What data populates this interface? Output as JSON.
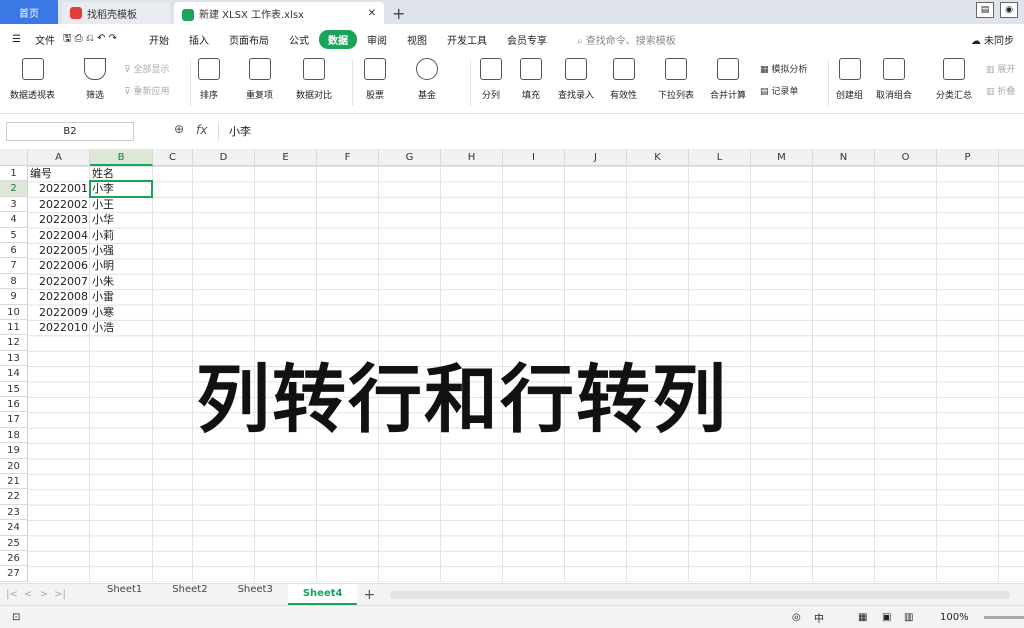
{
  "tabs": {
    "home": "首页",
    "template": "找稻壳模板",
    "file": "新建 XLSX 工作表.xlsx",
    "add": "+"
  },
  "menu": {
    "file": "文件",
    "items": [
      "开始",
      "插入",
      "页面布局",
      "公式",
      "数据",
      "审阅",
      "视图",
      "开发工具",
      "会员专享"
    ],
    "active_index": 4,
    "search_placeholder": "查找命令、搜索模板",
    "sync": "未同步"
  },
  "ribbon": {
    "pivot": "数据透视表",
    "filter": "筛选",
    "show_all": "全部显示",
    "reapply": "重新应用",
    "sort": "排序",
    "duplicates": "重复项",
    "compare": "数据对比",
    "stock": "股票",
    "fund": "基金",
    "split": "分列",
    "fill": "填充",
    "lookup_entry": "查找录入",
    "validity": "有效性",
    "dropdown": "下拉列表",
    "consolidate": "合并计算",
    "whatif": "模拟分析",
    "record": "记录单",
    "group": "创建组",
    "ungroup": "取消组合",
    "subtotal": "分类汇总",
    "expand": "展开",
    "collapse": "折叠"
  },
  "formula_bar": {
    "name_box": "B2",
    "fx": "fx",
    "value": "小李"
  },
  "columns": [
    "A",
    "B",
    "C",
    "D",
    "E",
    "F",
    "G",
    "H",
    "I",
    "J",
    "K",
    "L",
    "M",
    "N",
    "O",
    "P"
  ],
  "rows": [
    "1",
    "2",
    "3",
    "4",
    "5",
    "6",
    "7",
    "8",
    "9",
    "10",
    "11",
    "12",
    "13",
    "14",
    "15",
    "16",
    "17",
    "18",
    "19",
    "20",
    "21",
    "22",
    "23",
    "24",
    "25",
    "26",
    "27"
  ],
  "table": {
    "header": [
      "编号",
      "姓名"
    ],
    "rows": [
      [
        "2022001",
        "小李"
      ],
      [
        "2022002",
        "小王"
      ],
      [
        "2022003",
        "小华"
      ],
      [
        "2022004",
        "小莉"
      ],
      [
        "2022005",
        "小强"
      ],
      [
        "2022006",
        "小明"
      ],
      [
        "2022007",
        "小朱"
      ],
      [
        "2022008",
        "小雷"
      ],
      [
        "2022009",
        "小寒"
      ],
      [
        "2022010",
        "小浩"
      ]
    ]
  },
  "overlay_text": "列转行和行转列",
  "sheets": [
    "Sheet1",
    "Sheet2",
    "Sheet3",
    "Sheet4"
  ],
  "active_sheet": 3,
  "status": {
    "zoom": "100%",
    "ime": "中"
  },
  "colors": {
    "accent": "#1aa35a",
    "home_tab": "#3a78e6"
  }
}
